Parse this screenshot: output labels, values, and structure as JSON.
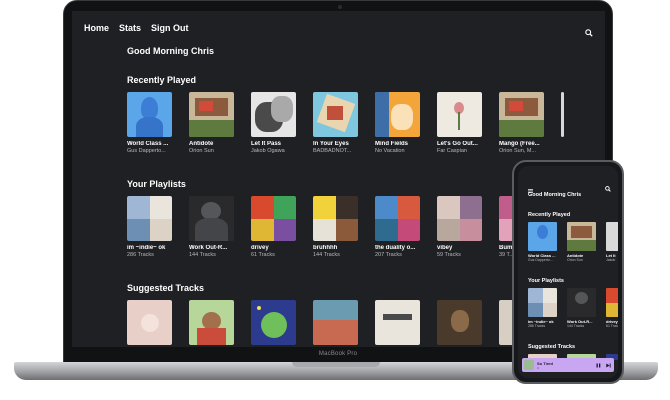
{
  "nav": {
    "home": "Home",
    "stats": "Stats",
    "sign_out": "Sign Out"
  },
  "greeting": "Good Morning Chris",
  "sections": {
    "recent": "Recently Played",
    "playlists": "Your Playlists",
    "suggested": "Suggested Tracks"
  },
  "recent": [
    {
      "title": "World Class ...",
      "sub": "Gus Dapperto..."
    },
    {
      "title": "Antidote",
      "sub": "Orion Sun"
    },
    {
      "title": "Let It Pass",
      "sub": "Jakob Ogawa"
    },
    {
      "title": "In Your Eyes",
      "sub": "BADBADNOT..."
    },
    {
      "title": "Mind Fields",
      "sub": "No Vacation"
    },
    {
      "title": "Let's Go Out...",
      "sub": "Far Caspian"
    },
    {
      "title": "Mango (Free...",
      "sub": "Orion Sun, M..."
    }
  ],
  "playlists": [
    {
      "title": "im ~indie~ ok",
      "sub": "286 Tracks"
    },
    {
      "title": "Work Out-R...",
      "sub": "144 Tracks"
    },
    {
      "title": "drivey",
      "sub": "61 Tracks"
    },
    {
      "title": "bruhhhh",
      "sub": "144 Tracks"
    },
    {
      "title": "the duality o...",
      "sub": "207 Tracks"
    },
    {
      "title": "vibey",
      "sub": "59 Tracks"
    },
    {
      "title": "Bum...",
      "sub": "39 T..."
    }
  ],
  "laptop_label": "MacBook Pro",
  "phone": {
    "greeting": "Good Morning Chris",
    "recent_title": "Recently Played",
    "playlists_title": "Your Playlists",
    "suggested_title": "Suggested Tracks",
    "recent": [
      {
        "title": "World Class ...",
        "sub": "Gus Dapperto..."
      },
      {
        "title": "Antidote",
        "sub": "Orion Sun"
      },
      {
        "title": "Let It",
        "sub": "Jakob"
      }
    ],
    "playlists": [
      {
        "title": "im ~indie~ ok",
        "sub": "286 Tracks"
      },
      {
        "title": "Work Out-R...",
        "sub": "144 Tracks"
      },
      {
        "title": "drivey",
        "sub": "61 Tracks"
      }
    ],
    "player": {
      "title": "So Tired",
      "artist": "rl"
    }
  },
  "icons": {
    "search": "search-icon",
    "menu": "menu-icon",
    "pause": "pause-icon",
    "next": "skip-next-icon"
  },
  "colors": {
    "app_bg": "#1f2023",
    "player": "#c9a6f2",
    "bezel": "#111214"
  }
}
